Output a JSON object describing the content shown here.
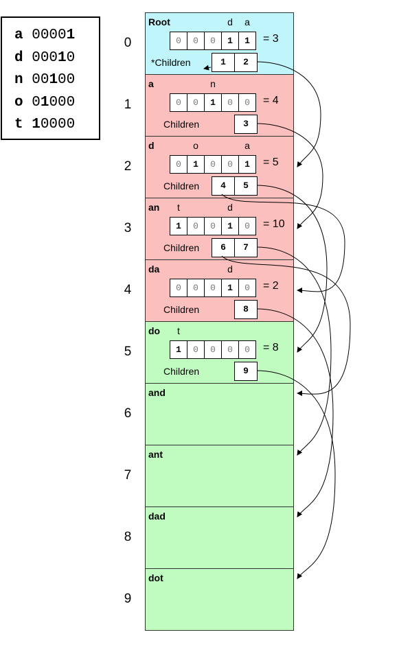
{
  "legend": [
    {
      "letter": "a",
      "pre": "0000",
      "on": "1",
      "post": ""
    },
    {
      "letter": "d",
      "pre": "000",
      "on": "1",
      "post": "0"
    },
    {
      "letter": "n",
      "pre": "00",
      "on": "1",
      "post": "00"
    },
    {
      "letter": "o",
      "pre": "0",
      "on": "1",
      "post": "000"
    },
    {
      "letter": "t",
      "pre": "",
      "on": "1",
      "post": "0000"
    }
  ],
  "colors": {
    "root": "#c0f5fb",
    "internal": "#fbbfbe",
    "leaf": "#c0fbc0"
  },
  "rows": [
    {
      "index": "0",
      "label": "Root",
      "kind": "root",
      "headers": [
        "",
        "",
        "",
        "d",
        "a"
      ],
      "bits": [
        "0",
        "0",
        "0",
        "1",
        "1"
      ],
      "value": "= 3",
      "children_label": "*Children",
      "children": [
        "1",
        "2"
      ]
    },
    {
      "index": "1",
      "label": "a",
      "kind": "internal",
      "headers": [
        "",
        "",
        "n",
        "",
        ""
      ],
      "bits": [
        "0",
        "0",
        "1",
        "0",
        "0"
      ],
      "value": "= 4",
      "children_label": "Children",
      "children": [
        "3"
      ]
    },
    {
      "index": "2",
      "label": "d",
      "kind": "internal",
      "headers": [
        "",
        "o",
        "",
        "",
        "a"
      ],
      "bits": [
        "0",
        "1",
        "0",
        "0",
        "1"
      ],
      "value": "= 5",
      "children_label": "Children",
      "children": [
        "4",
        "5"
      ]
    },
    {
      "index": "3",
      "label": "an",
      "kind": "internal",
      "headers": [
        "t",
        "",
        "",
        "d",
        ""
      ],
      "bits": [
        "1",
        "0",
        "0",
        "1",
        "0"
      ],
      "value": "= 10",
      "children_label": "Children",
      "children": [
        "6",
        "7"
      ]
    },
    {
      "index": "4",
      "label": "da",
      "kind": "internal",
      "headers": [
        "",
        "",
        "",
        "d",
        ""
      ],
      "bits": [
        "0",
        "0",
        "0",
        "1",
        "0"
      ],
      "value": "= 2",
      "children_label": "Children",
      "children": [
        "8"
      ]
    },
    {
      "index": "5",
      "label": "do",
      "kind": "leaf",
      "headers": [
        "t",
        "",
        "",
        "",
        ""
      ],
      "bits": [
        "1",
        "0",
        "0",
        "0",
        "0"
      ],
      "value": "= 8",
      "children_label": "Children",
      "children": [
        "9"
      ]
    },
    {
      "index": "6",
      "label": "and",
      "kind": "leaf"
    },
    {
      "index": "7",
      "label": "ant",
      "kind": "leaf"
    },
    {
      "index": "8",
      "label": "dad",
      "kind": "leaf"
    },
    {
      "index": "9",
      "label": "dot",
      "kind": "leaf"
    }
  ]
}
